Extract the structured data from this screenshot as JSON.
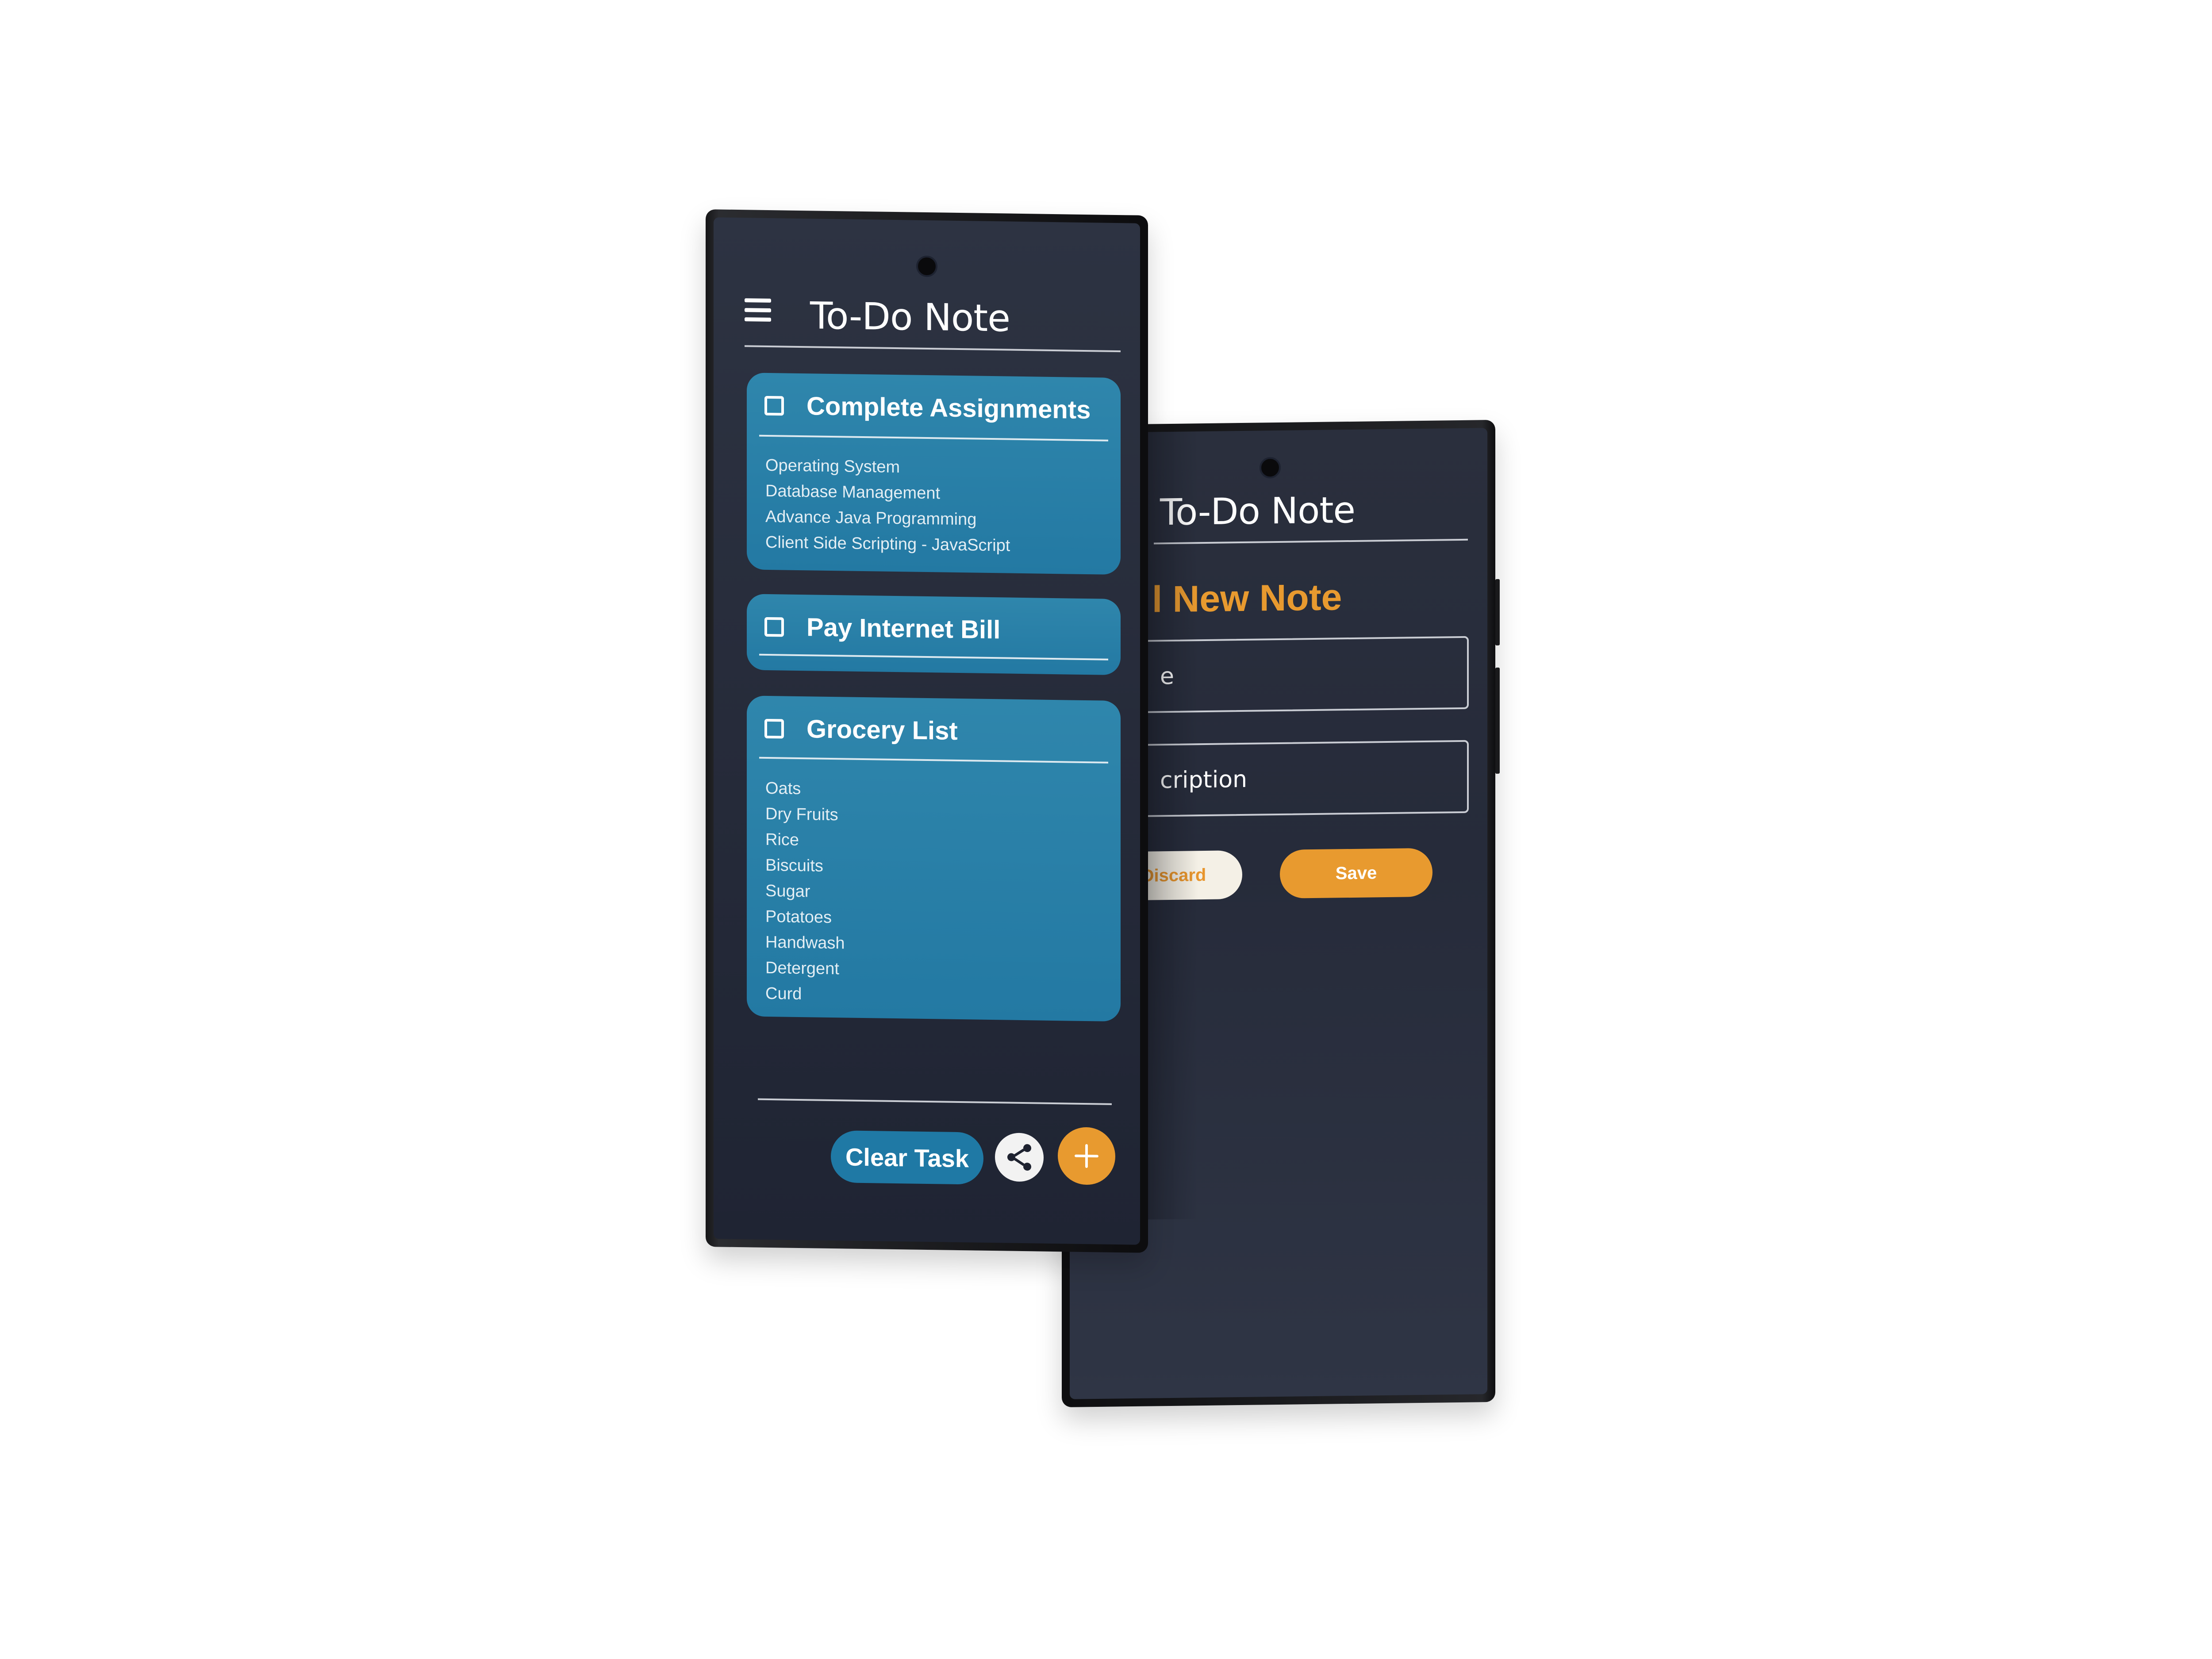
{
  "front_screen": {
    "title": "To-Do Note",
    "tasks": [
      {
        "title": "Complete Assignments",
        "checked": false,
        "items": [
          "Operating System",
          "Database Management",
          "Advance Java Programming",
          "Client Side Scripting - JavaScript"
        ]
      },
      {
        "title": "Pay Internet Bill",
        "checked": false,
        "items": []
      },
      {
        "title": "Grocery List",
        "checked": false,
        "items": [
          "Oats",
          "Dry Fruits",
          "Rice",
          "Biscuits",
          "Sugar",
          "Potatoes",
          "Handwash",
          "Detergent",
          "Curd"
        ]
      }
    ],
    "footer": {
      "clear_label": "Clear Task",
      "share_icon": "share-icon",
      "add_icon": "plus-icon"
    }
  },
  "back_screen": {
    "title": "To-Do Note",
    "heading": "l New Note",
    "title_field_text": "e",
    "description_field_text": "cription",
    "discard_label": "Discard",
    "save_label": "Save"
  },
  "colors": {
    "screen_bg": "#262b3a",
    "card_blue": "#2379a3",
    "accent_orange": "#e89a2f",
    "discard_bg": "#f4f0e6"
  }
}
